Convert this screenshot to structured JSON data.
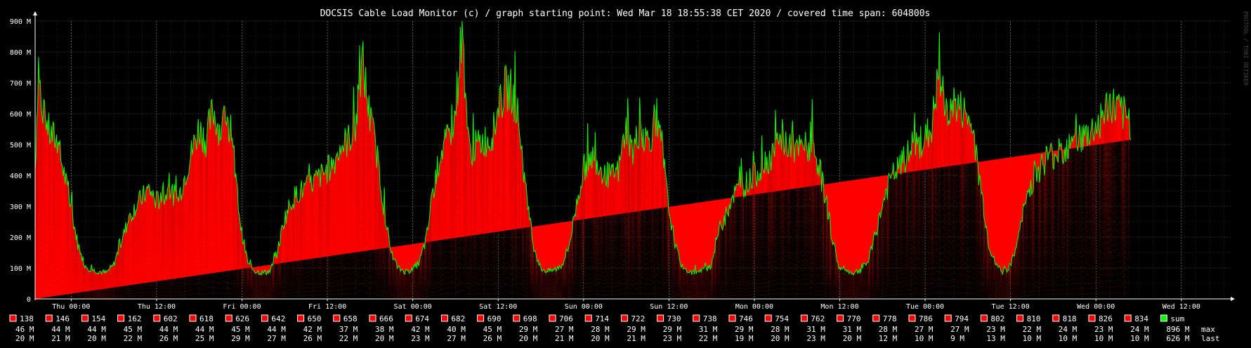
{
  "chart_data": {
    "type": "area",
    "title": "DOCSIS Cable Load Monitor (c) / graph starting point: Wed Mar 18 18:55:38 CET 2020 / covered time span: 604800s",
    "watermark": "PROTOOL / TOBI OETIKER",
    "xlabel": "",
    "ylabel": "",
    "ylim": [
      0,
      900
    ],
    "y_unit": "M",
    "y_ticks": [
      "0",
      "100 M",
      "200 M",
      "300 M",
      "400 M",
      "500 M",
      "600 M",
      "700 M",
      "800 M",
      "900 M"
    ],
    "x_ticks": [
      "Thu 00:00",
      "Thu 12:00",
      "Fri 00:00",
      "Fri 12:00",
      "Sat 00:00",
      "Sat 12:00",
      "Sun 00:00",
      "Sun 12:00",
      "Mon 00:00",
      "Mon 12:00",
      "Tue 00:00",
      "Tue 12:00",
      "Wed 00:00",
      "Wed 12:00"
    ],
    "x_tick_hours": [
      5.07,
      17.07,
      29.07,
      41.07,
      53.07,
      65.07,
      77.07,
      89.07,
      101.07,
      113.07,
      125.07,
      137.07,
      149.07,
      161.07
    ],
    "x_range_hours": [
      0,
      168
    ],
    "grid": true,
    "stacked": true,
    "sum_series": {
      "name": "sum",
      "x_hours": [
        0,
        0.5,
        1,
        1.5,
        2,
        3,
        4,
        5,
        6,
        7,
        8,
        9,
        10,
        11,
        12,
        13,
        14,
        15,
        16,
        17,
        18,
        19,
        20,
        21,
        22,
        23,
        24,
        25,
        26,
        27,
        28,
        29,
        30,
        31,
        32,
        33,
        34,
        35,
        36,
        37,
        38,
        39,
        40,
        41,
        42,
        43,
        44,
        45,
        46,
        47,
        48,
        49,
        50,
        51,
        52,
        53,
        54,
        55,
        56,
        57,
        58,
        59,
        60,
        61,
        62,
        63,
        64,
        65,
        66,
        67,
        68,
        69,
        70,
        71,
        72,
        73,
        74,
        75,
        76,
        77,
        78,
        79,
        80,
        81,
        82,
        83,
        84,
        85,
        86,
        87,
        88,
        89,
        90,
        91,
        92,
        93,
        94,
        95,
        96,
        97,
        98,
        99,
        100,
        101,
        102,
        103,
        104,
        105,
        106,
        107,
        108,
        109,
        110,
        111,
        112,
        113,
        114,
        115,
        116,
        117,
        118,
        119,
        120,
        121,
        122,
        123,
        124,
        125,
        126,
        127,
        128,
        129,
        130,
        131,
        132,
        133,
        134,
        135,
        136,
        137,
        138,
        139,
        140,
        141,
        142,
        143,
        144,
        145,
        146,
        147,
        148,
        149,
        150,
        151,
        152,
        153,
        154,
        155,
        156,
        157,
        158,
        159,
        160,
        161,
        162,
        163,
        164,
        165,
        166,
        167,
        168
      ],
      "values": [
        420,
        790,
        560,
        600,
        540,
        520,
        420,
        300,
        180,
        110,
        95,
        90,
        85,
        110,
        180,
        250,
        300,
        330,
        360,
        320,
        330,
        360,
        320,
        400,
        480,
        560,
        520,
        620,
        550,
        600,
        430,
        220,
        110,
        90,
        85,
        90,
        150,
        260,
        320,
        350,
        360,
        380,
        400,
        420,
        450,
        500,
        520,
        560,
        780,
        600,
        480,
        300,
        150,
        100,
        90,
        95,
        120,
        200,
        360,
        480,
        520,
        600,
        880,
        480,
        500,
        520,
        520,
        600,
        690,
        680,
        580,
        340,
        180,
        100,
        90,
        95,
        110,
        170,
        300,
        420,
        470,
        450,
        410,
        400,
        420,
        560,
        480,
        560,
        520,
        550,
        520,
        300,
        170,
        100,
        90,
        85,
        95,
        110,
        220,
        270,
        340,
        360,
        380,
        400,
        430,
        460,
        480,
        520,
        500,
        480,
        500,
        490,
        450,
        340,
        200,
        100,
        90,
        85,
        95,
        120,
        200,
        300,
        380,
        420,
        450,
        480,
        500,
        520,
        560,
        740,
        600,
        640,
        620,
        600,
        500,
        350,
        180,
        110,
        90,
        100,
        180,
        300,
        380,
        420,
        460,
        470,
        480,
        500,
        560,
        520,
        540,
        560,
        600,
        640,
        620,
        600,
        580
      ]
    },
    "legend_channels": [
      {
        "name": "138",
        "max": "46 M",
        "last": "20 M"
      },
      {
        "name": "146",
        "max": "44 M",
        "last": "21 M"
      },
      {
        "name": "154",
        "max": "44 M",
        "last": "20 M"
      },
      {
        "name": "162",
        "max": "45 M",
        "last": "22 M"
      },
      {
        "name": "602",
        "max": "44 M",
        "last": "26 M"
      },
      {
        "name": "618",
        "max": "44 M",
        "last": "25 M"
      },
      {
        "name": "626",
        "max": "45 M",
        "last": "29 M"
      },
      {
        "name": "642",
        "max": "44 M",
        "last": "27 M"
      },
      {
        "name": "650",
        "max": "42 M",
        "last": "26 M"
      },
      {
        "name": "658",
        "max": "37 M",
        "last": "22 M"
      },
      {
        "name": "666",
        "max": "38 M",
        "last": "20 M"
      },
      {
        "name": "674",
        "max": "42 M",
        "last": "23 M"
      },
      {
        "name": "682",
        "max": "40 M",
        "last": "27 M"
      },
      {
        "name": "690",
        "max": "45 M",
        "last": "26 M"
      },
      {
        "name": "698",
        "max": "29 M",
        "last": "20 M"
      },
      {
        "name": "706",
        "max": "27 M",
        "last": "21 M"
      },
      {
        "name": "714",
        "max": "28 M",
        "last": "20 M"
      },
      {
        "name": "722",
        "max": "29 M",
        "last": "21 M"
      },
      {
        "name": "730",
        "max": "29 M",
        "last": "23 M"
      },
      {
        "name": "738",
        "max": "31 M",
        "last": "22 M"
      },
      {
        "name": "746",
        "max": "29 M",
        "last": "19 M"
      },
      {
        "name": "754",
        "max": "28 M",
        "last": "20 M"
      },
      {
        "name": "762",
        "max": "31 M",
        "last": "23 M"
      },
      {
        "name": "770",
        "max": "31 M",
        "last": "20 M"
      },
      {
        "name": "778",
        "max": "28 M",
        "last": "12 M"
      },
      {
        "name": "786",
        "max": "27 M",
        "last": "10 M"
      },
      {
        "name": "794",
        "max": "27 M",
        "last": "9 M"
      },
      {
        "name": "802",
        "max": "23 M",
        "last": "13 M"
      },
      {
        "name": "810",
        "max": "22 M",
        "last": "10 M"
      },
      {
        "name": "818",
        "max": "24 M",
        "last": "10 M"
      },
      {
        "name": "826",
        "max": "23 M",
        "last": "10 M"
      },
      {
        "name": "834",
        "max": "24 M",
        "last": "10 M"
      },
      {
        "name": "sum",
        "max": "896 M",
        "last": "626 M"
      }
    ],
    "legend_row_labels": {
      "max": "max",
      "last": "last"
    },
    "colors": {
      "background": "#000000",
      "grid": "#555555",
      "channel_fill": "#ff0000",
      "channel_line": "#b00000",
      "sum_line": "#00ff00",
      "text": "#ffffff"
    }
  }
}
